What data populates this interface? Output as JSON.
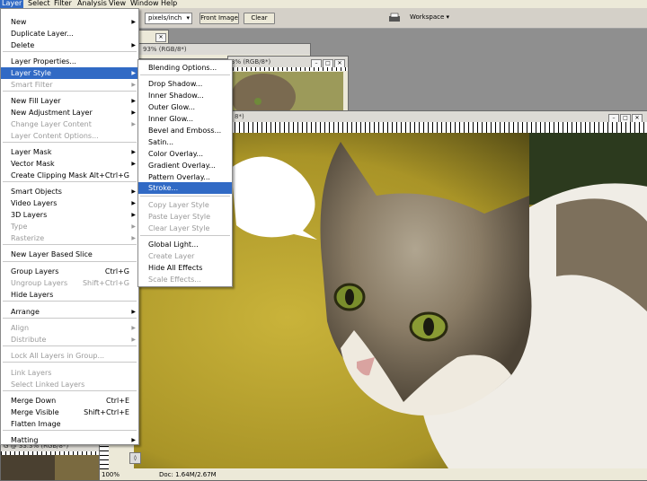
{
  "menubar": {
    "items": [
      "Layer",
      "Select",
      "Filter",
      "Analysis",
      "View",
      "Window",
      "Help"
    ],
    "active": "Layer"
  },
  "options_bar": {
    "resolution_unit": "pixels/inch",
    "front_image": "Front Image",
    "clear": "Clear",
    "workspace": "Workspace ▾"
  },
  "doc_back_left": {
    "zoom_title": "G @ 33.3% (RGB/8*)"
  },
  "doc_mid": {
    "title": "93% (RGB/8*)"
  },
  "doc_mid2": {
    "title": "3% (RGB/8*)"
  },
  "doc_front": {
    "title": "8*)",
    "status_zoom": "100%",
    "status_doc": "Doc: 1.64M/2.67M"
  },
  "layer_menu": {
    "items": [
      {
        "label": "New",
        "shortcut": "",
        "arrow": true,
        "disabled": false
      },
      {
        "label": "Duplicate Layer...",
        "shortcut": "",
        "arrow": false,
        "disabled": false
      },
      {
        "label": "Delete",
        "shortcut": "",
        "arrow": true,
        "disabled": false
      },
      {
        "label": "Layer Properties...",
        "shortcut": "",
        "arrow": false,
        "disabled": false
      },
      {
        "label": "Layer Style",
        "shortcut": "",
        "arrow": true,
        "disabled": false,
        "highlight": true
      },
      {
        "label": "Smart Filter",
        "shortcut": "",
        "arrow": true,
        "disabled": true
      },
      {
        "label": "New Fill Layer",
        "shortcut": "",
        "arrow": true,
        "disabled": false
      },
      {
        "label": "New Adjustment Layer",
        "shortcut": "",
        "arrow": true,
        "disabled": false
      },
      {
        "label": "Change Layer Content",
        "shortcut": "",
        "arrow": true,
        "disabled": true
      },
      {
        "label": "Layer Content Options...",
        "shortcut": "",
        "arrow": false,
        "disabled": true
      },
      {
        "label": "Layer Mask",
        "shortcut": "",
        "arrow": true,
        "disabled": false
      },
      {
        "label": "Vector Mask",
        "shortcut": "",
        "arrow": true,
        "disabled": false
      },
      {
        "label": "Create Clipping Mask",
        "shortcut": "Alt+Ctrl+G",
        "arrow": false,
        "disabled": false
      },
      {
        "label": "Smart Objects",
        "shortcut": "",
        "arrow": true,
        "disabled": false
      },
      {
        "label": "Video Layers",
        "shortcut": "",
        "arrow": true,
        "disabled": false
      },
      {
        "label": "3D Layers",
        "shortcut": "",
        "arrow": true,
        "disabled": false
      },
      {
        "label": "Type",
        "shortcut": "",
        "arrow": true,
        "disabled": true
      },
      {
        "label": "Rasterize",
        "shortcut": "",
        "arrow": true,
        "disabled": true
      },
      {
        "label": "New Layer Based Slice",
        "shortcut": "",
        "arrow": false,
        "disabled": false
      },
      {
        "label": "Group Layers",
        "shortcut": "Ctrl+G",
        "arrow": false,
        "disabled": false
      },
      {
        "label": "Ungroup Layers",
        "shortcut": "Shift+Ctrl+G",
        "arrow": false,
        "disabled": true
      },
      {
        "label": "Hide Layers",
        "shortcut": "",
        "arrow": false,
        "disabled": false
      },
      {
        "label": "Arrange",
        "shortcut": "",
        "arrow": true,
        "disabled": false
      },
      {
        "label": "Align",
        "shortcut": "",
        "arrow": true,
        "disabled": true
      },
      {
        "label": "Distribute",
        "shortcut": "",
        "arrow": true,
        "disabled": true
      },
      {
        "label": "Lock All Layers in Group...",
        "shortcut": "",
        "arrow": false,
        "disabled": true
      },
      {
        "label": "Link Layers",
        "shortcut": "",
        "arrow": false,
        "disabled": true
      },
      {
        "label": "Select Linked Layers",
        "shortcut": "",
        "arrow": false,
        "disabled": true
      },
      {
        "label": "Merge Down",
        "shortcut": "Ctrl+E",
        "arrow": false,
        "disabled": false
      },
      {
        "label": "Merge Visible",
        "shortcut": "Shift+Ctrl+E",
        "arrow": false,
        "disabled": false
      },
      {
        "label": "Flatten Image",
        "shortcut": "",
        "arrow": false,
        "disabled": false
      },
      {
        "label": "Matting",
        "shortcut": "",
        "arrow": true,
        "disabled": false
      }
    ]
  },
  "layer_style_menu": {
    "items": [
      {
        "label": "Blending Options...",
        "disabled": false
      },
      {
        "label": "Drop Shadow...",
        "disabled": false
      },
      {
        "label": "Inner Shadow...",
        "disabled": false
      },
      {
        "label": "Outer Glow...",
        "disabled": false
      },
      {
        "label": "Inner Glow...",
        "disabled": false
      },
      {
        "label": "Bevel and Emboss...",
        "disabled": false
      },
      {
        "label": "Satin...",
        "disabled": false
      },
      {
        "label": "Color Overlay...",
        "disabled": false
      },
      {
        "label": "Gradient Overlay...",
        "disabled": false
      },
      {
        "label": "Pattern Overlay...",
        "disabled": false
      },
      {
        "label": "Stroke...",
        "disabled": false,
        "highlight": true
      },
      {
        "label": "Copy Layer Style",
        "disabled": true
      },
      {
        "label": "Paste Layer Style",
        "disabled": true
      },
      {
        "label": "Clear Layer Style",
        "disabled": true
      },
      {
        "label": "Global Light...",
        "disabled": false
      },
      {
        "label": "Create Layer",
        "disabled": true
      },
      {
        "label": "Hide All Effects",
        "disabled": false
      },
      {
        "label": "Scale Effects...",
        "disabled": true
      }
    ]
  }
}
